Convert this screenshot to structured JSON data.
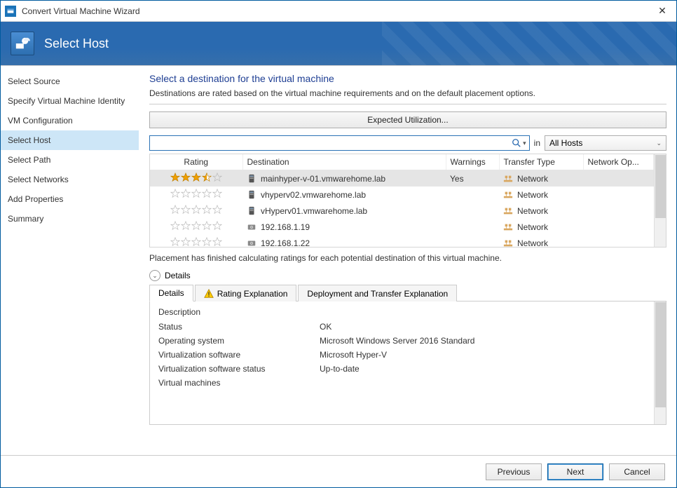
{
  "window_title": "Convert Virtual Machine Wizard",
  "banner": {
    "title": "Select Host"
  },
  "sidebar": {
    "items": [
      {
        "label": "Select Source"
      },
      {
        "label": "Specify Virtual Machine Identity"
      },
      {
        "label": "VM Configuration"
      },
      {
        "label": "Select Host"
      },
      {
        "label": "Select Path"
      },
      {
        "label": "Select Networks"
      },
      {
        "label": "Add Properties"
      },
      {
        "label": "Summary"
      }
    ],
    "active_index": 3
  },
  "main": {
    "heading": "Select a destination for the virtual machine",
    "subtext": "Destinations are rated based on the virtual machine requirements and on the default placement options.",
    "expected_util_btn": "Expected Utilization...",
    "search_placeholder": "",
    "in_label": "in",
    "scope_combo": "All Hosts",
    "columns": {
      "rating": "Rating",
      "destination": "Destination",
      "warnings": "Warnings",
      "transfer_type": "Transfer Type",
      "network_opt": "Network Op..."
    },
    "rows": [
      {
        "rating_full": 3,
        "rating_half": 1,
        "rating_empty": 1,
        "icon": "server",
        "destination": "mainhyper-v-01.vmwarehome.lab",
        "warnings": "Yes",
        "transfer_type": "Network",
        "selected": true
      },
      {
        "rating_full": 0,
        "rating_half": 0,
        "rating_empty": 5,
        "icon": "server",
        "destination": "vhyperv02.vmwarehome.lab",
        "warnings": "",
        "transfer_type": "Network",
        "selected": false
      },
      {
        "rating_full": 0,
        "rating_half": 0,
        "rating_empty": 5,
        "icon": "server",
        "destination": "vHyperv01.vmwarehome.lab",
        "warnings": "",
        "transfer_type": "Network",
        "selected": false
      },
      {
        "rating_full": 0,
        "rating_half": 0,
        "rating_empty": 5,
        "icon": "disk",
        "destination": "192.168.1.19",
        "warnings": "",
        "transfer_type": "Network",
        "selected": false
      },
      {
        "rating_full": 0,
        "rating_half": 0,
        "rating_empty": 5,
        "icon": "disk",
        "destination": "192.168.1.22",
        "warnings": "",
        "transfer_type": "Network",
        "selected": false
      }
    ],
    "placement_msg": "Placement has finished calculating ratings for each potential destination of this virtual machine.",
    "details_toggle_label": "Details",
    "details_tabs": [
      {
        "label": "Details",
        "warn": false
      },
      {
        "label": "Rating Explanation",
        "warn": true
      },
      {
        "label": "Deployment and Transfer Explanation",
        "warn": false
      }
    ],
    "details_active_tab": 0,
    "details_panel": {
      "description_label": "Description",
      "rows": [
        {
          "label": "Status",
          "value": "OK"
        },
        {
          "label": "Operating system",
          "value": "Microsoft Windows Server 2016 Standard"
        },
        {
          "label": "Virtualization software",
          "value": "Microsoft Hyper-V"
        },
        {
          "label": "Virtualization software status",
          "value": "Up-to-date"
        },
        {
          "label": "Virtual machines",
          "value": ""
        }
      ]
    }
  },
  "footer": {
    "previous": "Previous",
    "next": "Next",
    "cancel": "Cancel"
  },
  "icons": {
    "search": "search-icon",
    "chevron": "chevron-down-icon"
  }
}
